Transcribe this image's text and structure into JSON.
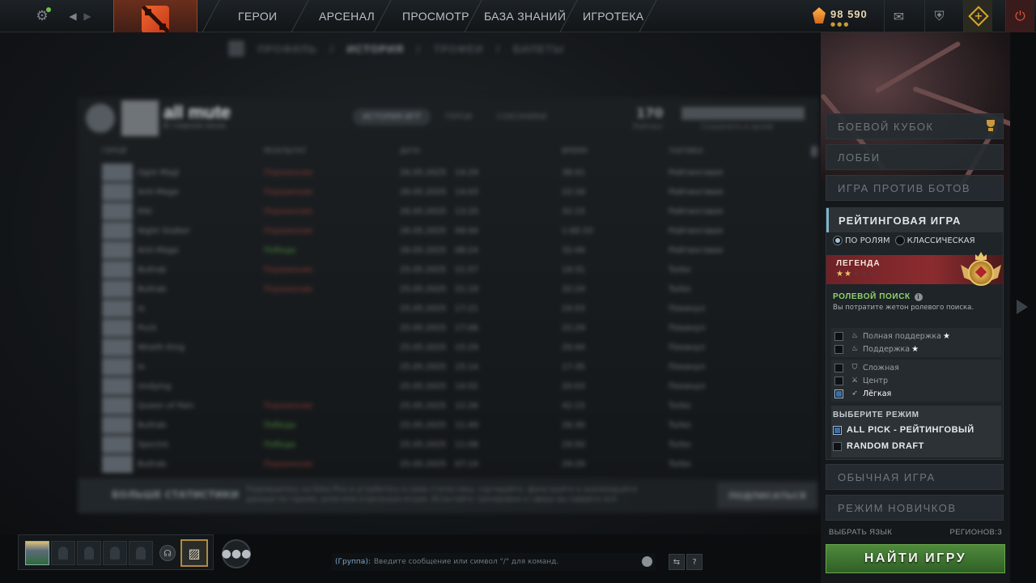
{
  "topbar": {
    "nav": [
      "ГЕРОИ",
      "АРСЕНАЛ",
      "ПРОСМОТР",
      "БАЗА ЗНАНИЙ",
      "ИГРОТЕКА"
    ],
    "currency_value": "98 590",
    "currency_dots": "●●●"
  },
  "profile": {
    "subnav": [
      "ПРОФИЛЬ",
      "ИСТОРИЯ",
      "ТРОФЕИ",
      "БИЛЕТЫ"
    ],
    "player_name": "all mute",
    "player_status": "В главном меню",
    "tabs": [
      "ИСТОРИЯ ИГР",
      "ГЕРОИ",
      "СОЮЗНИКИ"
    ],
    "stat_value": "170",
    "stat_label": "Рейтинг",
    "stat_bar_label": "Сохранить в архив",
    "columns": [
      "ГЕРОЙ",
      "РЕЗУЛЬТАТ",
      "ДАТА",
      "ВРЕМЯ",
      "ТАКТИКА"
    ],
    "matches": [
      {
        "hero": "Ogre Magi",
        "result": "Поражение",
        "date": "26.05.2025",
        "time": "14:29",
        "duration": "38:41",
        "mode": "Рейтинговая"
      },
      {
        "hero": "Anti-Mage",
        "result": "Поражение",
        "date": "26.05.2025",
        "time": "14:03",
        "duration": "22:16",
        "mode": "Рейтинговая"
      },
      {
        "hero": "Riki",
        "result": "Поражение",
        "date": "26.05.2025",
        "time": "13:20",
        "duration": "32:15",
        "mode": "Рейтинговая"
      },
      {
        "hero": "Night Stalker",
        "result": "Поражение",
        "date": "26.05.2025",
        "time": "09:44",
        "duration": "1:00:33",
        "mode": "Рейтинговая"
      },
      {
        "hero": "Anti-Mage",
        "result": "Победа",
        "date": "26.05.2025",
        "time": "08:24",
        "duration": "32:44",
        "mode": "Рейтинговая"
      },
      {
        "hero": "Bullrab",
        "result": "Поражение",
        "date": "25.05.2025",
        "time": "21:57",
        "duration": "19:31",
        "mode": "Turbo"
      },
      {
        "hero": "Bullrab",
        "result": "Поражение",
        "date": "25.05.2025",
        "time": "21:19",
        "duration": "32:24",
        "mode": "Turbo"
      },
      {
        "hero": "Io",
        "result": "",
        "date": "25.05.2025",
        "time": "17:21",
        "duration": "24:53",
        "mode": "Покинул"
      },
      {
        "hero": "Puck",
        "result": "",
        "date": "25.05.2025",
        "time": "17:06",
        "duration": "22:29",
        "mode": "Покинул"
      },
      {
        "hero": "Wraith King",
        "result": "",
        "date": "25.05.2025",
        "time": "15:29",
        "duration": "20:44",
        "mode": "Покинул"
      },
      {
        "hero": "Io",
        "result": "",
        "date": "25.05.2025",
        "time": "15:14",
        "duration": "17:35",
        "mode": "Покинул"
      },
      {
        "hero": "Undying",
        "result": "",
        "date": "25.05.2025",
        "time": "14:52",
        "duration": "20:03",
        "mode": "Покинул"
      },
      {
        "hero": "Queen of Pain",
        "result": "Поражение",
        "date": "25.05.2025",
        "time": "12:26",
        "duration": "42:15",
        "mode": "Turbo"
      },
      {
        "hero": "Bullrab",
        "result": "Победа",
        "date": "25.05.2025",
        "time": "11:49",
        "duration": "26:30",
        "mode": "Turbo"
      },
      {
        "hero": "Spectre",
        "result": "Победа",
        "date": "25.05.2025",
        "time": "11:08",
        "duration": "29:50",
        "mode": "Turbo"
      },
      {
        "hero": "Bullrab",
        "result": "Поражение",
        "date": "25.05.2025",
        "time": "07:14",
        "duration": "29:29",
        "mode": "Turbo"
      }
    ],
    "banner_title": "БОЛЬШЕ СТАТИСТИКИ",
    "banner_text": "Подпишитесь на Dota Plus и углубитесь в свою статистику: сортируйте, фильтруйте и анализируйте данные по героям, роли или отдельным играм. Испытайте тренировки и сфера вы найдёте всё.",
    "banner_button": "ПОДПИСАТЬСЯ"
  },
  "right_panel": {
    "buttons": {
      "battle_cup": "БОЕВОЙ КУБОК",
      "lobby": "ЛОББИ",
      "bots": "ИГРА ПРОТИВ БОТОВ",
      "normal": "ОБЫЧНАЯ ИГРА",
      "new_player": "РЕЖИМ НОВИЧКОВ"
    },
    "ranked": {
      "title": "РЕЙТИНГОВАЯ ИГРА",
      "option_roles": "ПО РОЛЯМ",
      "option_classic": "КЛАССИЧЕСКАЯ",
      "rank_name": "ЛЕГЕНДА",
      "rank_stars_filled": "★★",
      "rank_stars_empty": "★★★",
      "role_search_title": "РОЛЕВОЙ ПОИСК",
      "role_search_note": "Вы потратите жетон ролевого поиска.",
      "roles_group1": [
        {
          "label": "Полная поддержка",
          "icon": "♨",
          "star": "★",
          "checked": false
        },
        {
          "label": "Поддержка",
          "icon": "♨",
          "star": "★",
          "checked": false
        }
      ],
      "roles_group2": [
        {
          "label": "Сложная",
          "icon": "⛉",
          "star": "",
          "checked": false
        },
        {
          "label": "Центр",
          "icon": "⚔",
          "star": "",
          "checked": false
        },
        {
          "label": "Лёгкая",
          "icon": "➶",
          "star": "",
          "checked": true
        }
      ],
      "mode_title": "ВЫБЕРИТЕ РЕЖИМ",
      "mode_all_pick": "ALL PICK - РЕЙТИНГОВЫЙ",
      "mode_random_draft": "RANDOM DRAFT"
    },
    "language": "ВЫБРАТЬ ЯЗЫК",
    "regions": "РЕГИОНОВ:3",
    "find_game": "НАЙТИ ИГРУ"
  },
  "chat": {
    "channel": "(Группа):",
    "placeholder": "Введите сообщение или символ \"/\" для команд.",
    "help": "?"
  },
  "colors": {
    "find_green": "#4f8a3c",
    "rank_red": "#8b2c2f",
    "accent_gold": "#d9a62c",
    "role_green": "#8fd36a"
  }
}
